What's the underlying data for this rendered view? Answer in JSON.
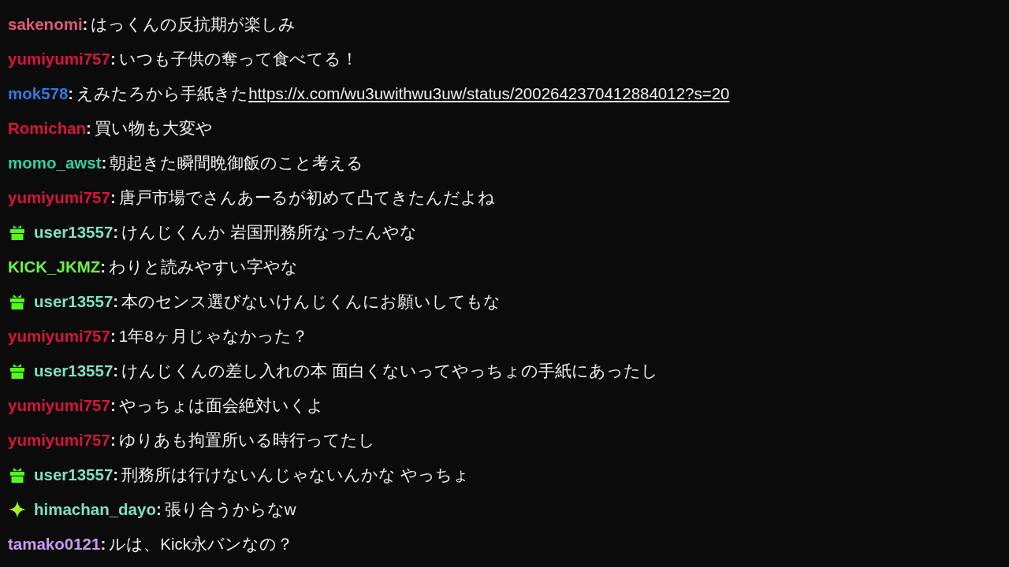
{
  "messages": [
    {
      "username": "sakenomi",
      "color": "#e05a78",
      "separator": ":",
      "text": "はっくんの反抗期が楽しみ"
    },
    {
      "username": "yumiyumi757",
      "color": "#d9143c",
      "separator": ":",
      "text": "いつも子供の奪って食べてる！"
    },
    {
      "username": "mok578",
      "color": "#2f7be0",
      "separator": ":",
      "text": "えみたろから手紙きた",
      "link": "https://x.com/wu3uwithwu3uw/status/2002642370412884012?s=20"
    },
    {
      "username": "Romichan",
      "color": "#d9143c",
      "separator": ":",
      "text": "買い物も大変や"
    },
    {
      "username": "momo_awst",
      "color": "#2fd0a0",
      "separator": ":",
      "text": "朝起きた瞬間晩御飯のこと考える"
    },
    {
      "username": "yumiyumi757",
      "color": "#d9143c",
      "separator": ":",
      "text": "唐戸市場でさんあーるが初めて凸てきたんだよね"
    },
    {
      "username": "user13557",
      "color": "#7fe0c8",
      "separator": ":",
      "badge": {
        "kind": "gift"
      },
      "text": "けんじくんか 岩国刑務所なったんやな"
    },
    {
      "username": "KICK_JKMZ",
      "color": "#6cf040",
      "separator": ":",
      "text": "わりと読みやすい字やな"
    },
    {
      "username": "user13557",
      "color": "#7fe0c8",
      "separator": ":",
      "badge": {
        "kind": "gift"
      },
      "text": "本のセンス選びないけんじくんにお願いしてもな"
    },
    {
      "username": "yumiyumi757",
      "color": "#d9143c",
      "separator": ":",
      "text": "1年8ヶ月じゃなかった？"
    },
    {
      "username": "user13557",
      "color": "#7fe0c8",
      "separator": ":",
      "badge": {
        "kind": "gift"
      },
      "text": "けんじくんの差し入れの本 面白くないってやっちょの手紙にあったし"
    },
    {
      "username": "yumiyumi757",
      "color": "#d9143c",
      "separator": ":",
      "text": "やっちょは面会絶対いくよ"
    },
    {
      "username": "yumiyumi757",
      "color": "#d9143c",
      "separator": ":",
      "text": "ゆりあも拘置所いる時行ってたし"
    },
    {
      "username": "user13557",
      "color": "#7fe0c8",
      "separator": ":",
      "badge": {
        "kind": "gift"
      },
      "text": "刑務所は行けないんじゃないんかな やっちょ"
    },
    {
      "username": "himachan_dayo",
      "color": "#7fe0c8",
      "separator": ":",
      "badge": {
        "kind": "sparkle"
      },
      "text": "張り合うからなw"
    },
    {
      "username": "tamako0121",
      "color": "#c89cf0",
      "separator": ":",
      "text": "ルは、Kick永バンなの？"
    }
  ]
}
